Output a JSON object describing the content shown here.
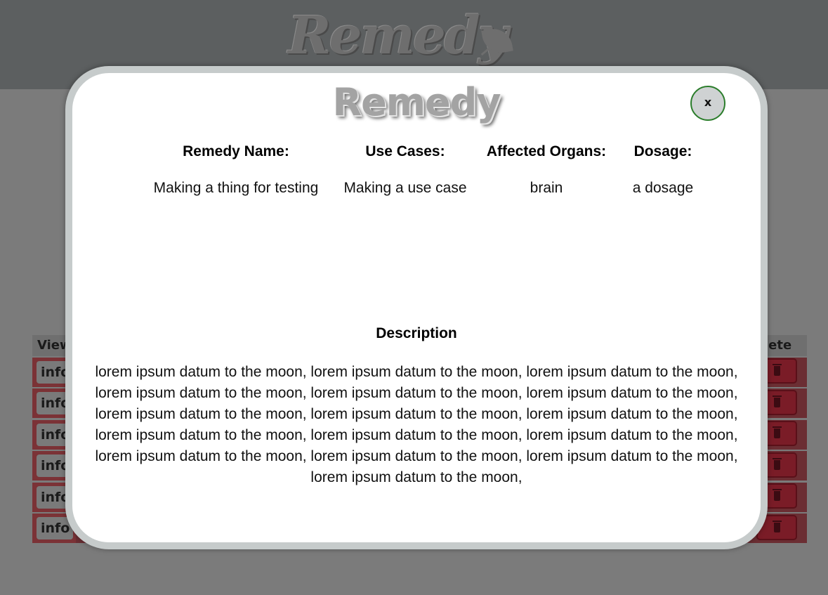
{
  "background": {
    "logo_text": "Remedy",
    "table": {
      "view_header": "View",
      "delete_header": "lete",
      "info_button_labels": [
        "info",
        "info",
        "info",
        "info",
        "info",
        "info"
      ]
    }
  },
  "modal": {
    "logo_text": "Remedy",
    "close_label": "x",
    "fields": {
      "name_label": "Remedy Name:",
      "name_value": "Making a thing for testing",
      "uses_label": "Use Cases:",
      "uses_value": "Making a use case",
      "organs_label": "Affected Organs:",
      "organs_value": "brain",
      "dosage_label": "Dosage:",
      "dosage_value": "a dosage"
    },
    "description_title": "Description",
    "description_text": "lorem ipsum datum to the moon, lorem ipsum datum to the moon, lorem ipsum datum to the moon, lorem ipsum datum to the moon, lorem ipsum datum to the moon, lorem ipsum datum to the moon, lorem ipsum datum to the moon, lorem ipsum datum to the moon, lorem ipsum datum to the moon, lorem ipsum datum to the moon, lorem ipsum datum to the moon, lorem ipsum datum to the moon, lorem ipsum datum to the moon, lorem ipsum datum to the moon, lorem ipsum datum to the moon, lorem ipsum datum to the moon,"
  },
  "colors": {
    "overlay": "#7b7b7b",
    "modal_border": "#c6cbcb",
    "close_border": "#2b7d2b",
    "row_red": "#6b2e33"
  }
}
